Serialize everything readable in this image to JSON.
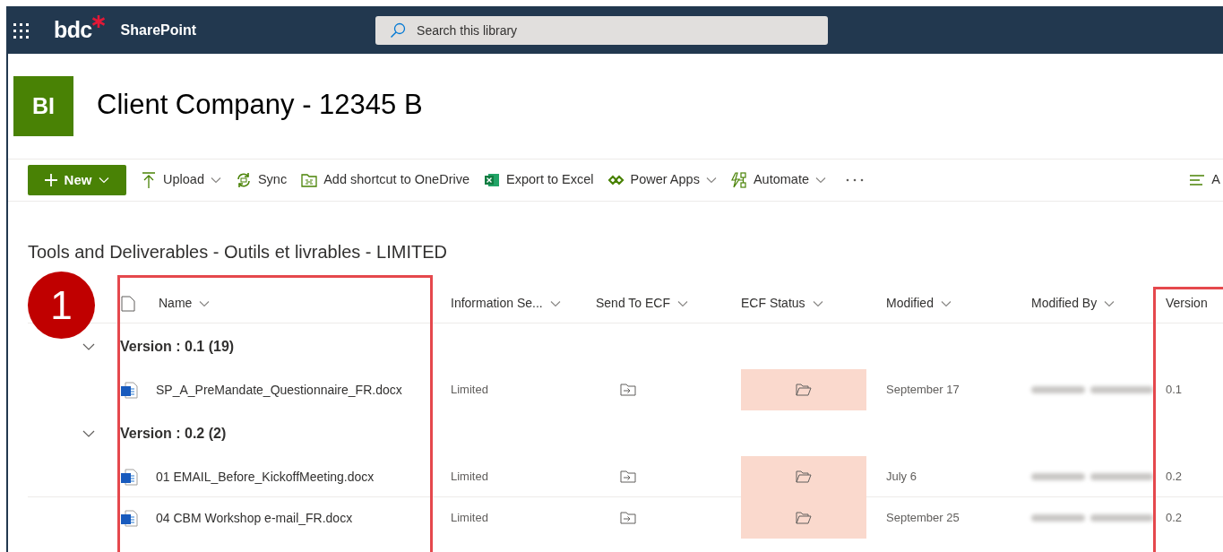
{
  "top_bar": {
    "brand": "bdc",
    "app_name": "SharePoint",
    "search": {
      "placeholder": "Search this library"
    }
  },
  "site": {
    "initials": "BI",
    "title": "Client Company - 12345 B"
  },
  "command_bar": [
    {
      "kind": "new",
      "label": "New"
    },
    {
      "kind": "upload",
      "label": "Upload",
      "dropdown": true
    },
    {
      "kind": "sync",
      "label": "Sync",
      "dropdown": false
    },
    {
      "kind": "shortcut",
      "label": "Add shortcut to OneDrive",
      "dropdown": false
    },
    {
      "kind": "excel",
      "label": "Export to Excel",
      "dropdown": false
    },
    {
      "kind": "powerapps",
      "label": "Power Apps",
      "dropdown": true
    },
    {
      "kind": "automate",
      "label": "Automate",
      "dropdown": true
    },
    {
      "kind": "more"
    },
    {
      "kind": "view",
      "label": "A"
    }
  ],
  "library": {
    "title": "Tools and Deliverables - Outils et livrables - LIMITED",
    "columns": [
      {
        "label": "Name",
        "menu": true
      },
      {
        "label": "Information Se...",
        "menu": true
      },
      {
        "label": "Send To ECF",
        "menu": true
      },
      {
        "label": "ECF Status",
        "menu": true
      },
      {
        "label": "Modified",
        "menu": true
      },
      {
        "label": "Modified By",
        "menu": true
      },
      {
        "label": "Version",
        "menu": false
      }
    ],
    "groups": [
      {
        "label": "Version : 0.1 (19)",
        "expanded": true,
        "rows": [
          {
            "name": "SP_A_PreMandate_Questionnaire_FR.docx",
            "information_security": "Limited",
            "modified": "September 17",
            "version": "0.1"
          }
        ]
      },
      {
        "label": "Version : 0.2 (2)",
        "expanded": true,
        "rows": [
          {
            "name": "01 EMAIL_Before_KickoffMeeting.docx",
            "information_security": "Limited",
            "modified": "July 6",
            "version": "0.2"
          },
          {
            "name": "04 CBM Workshop e-mail_FR.docx",
            "information_security": "Limited",
            "modified": "September 25",
            "version": "0.2"
          }
        ]
      }
    ]
  },
  "annotations": [
    {
      "kind": "number_marker",
      "label": "1"
    },
    {
      "kind": "frame"
    },
    {
      "kind": "frame"
    }
  ]
}
